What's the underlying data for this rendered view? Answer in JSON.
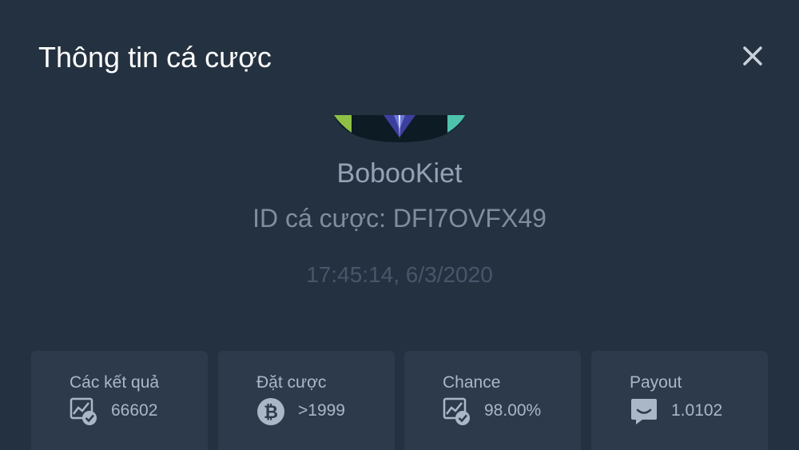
{
  "header": {
    "title": "Thông tin cá cược",
    "close_icon": "close-icon"
  },
  "player": {
    "username": "BobooKiet",
    "bet_id_label": "ID cá cược:",
    "bet_id": "DFI7OVFX49",
    "timestamp": "17:45:14, 6/3/2020"
  },
  "stats": [
    {
      "label": "Các kết quả",
      "value": "66602",
      "icon": "chart-check-icon"
    },
    {
      "label": "Đặt cược",
      "value": ">1999",
      "icon": "bitcoin-icon"
    },
    {
      "label": "Chance",
      "value": "98.00%",
      "icon": "chart-check-icon"
    },
    {
      "label": "Payout",
      "value": "1.0102",
      "icon": "smile-chat-icon"
    }
  ],
  "colors": {
    "background": "#243140",
    "card": "#2c3a4b",
    "title": "#ffffff",
    "muted_text": "#93a3b5"
  }
}
